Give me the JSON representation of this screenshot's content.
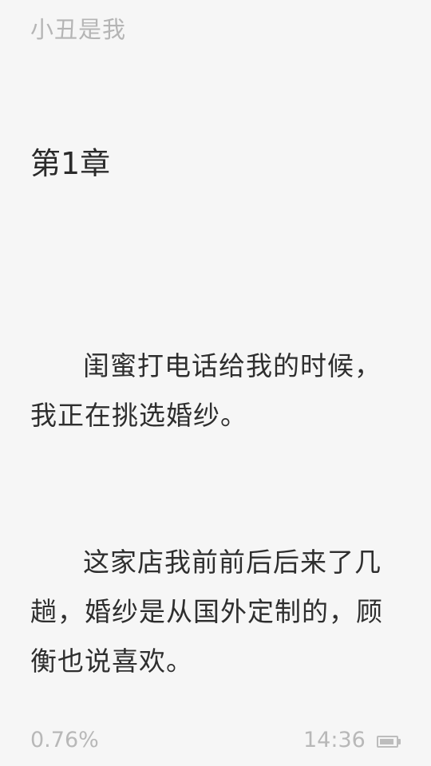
{
  "header": {
    "book_title": "小丑是我"
  },
  "chapter": {
    "title": "第1章",
    "paragraphs": [
      "闺蜜打电话给我的时候，我正在挑选婚纱。",
      "这家店我前前后后来了几趟，婚纱是从国外定制的，顾衡也说喜欢。"
    ]
  },
  "footer": {
    "progress": "0.76%",
    "time": "14:36",
    "battery_icon": "battery-icon",
    "battery_level": 0.9
  },
  "colors": {
    "background": "#f6f6f6",
    "text": "#2e2e2e",
    "muted": "#b5b5b5"
  }
}
